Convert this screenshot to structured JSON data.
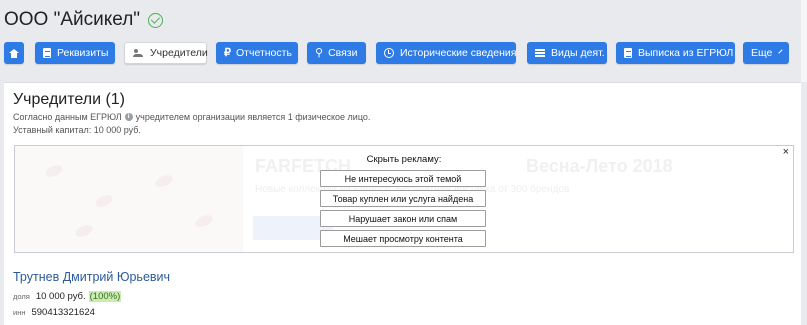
{
  "company": {
    "title": "ООО \"Айсикел\"",
    "verified_icon": "check-circle-icon"
  },
  "toolbar": {
    "home_icon": "home-icon",
    "buttons": [
      {
        "label": "Реквизиты",
        "icon": "document-icon"
      },
      {
        "label": "Учредители",
        "icon": "users-icon",
        "active": true
      },
      {
        "label": "Отчетность",
        "icon": "ruble-icon"
      },
      {
        "label": "Связи",
        "icon": "link-icon"
      },
      {
        "label": "Исторические сведения",
        "icon": "history-icon"
      },
      {
        "label": "Виды деят.",
        "icon": "list-icon"
      },
      {
        "label": "Выписка из ЕГРЮЛ",
        "icon": "document-icon"
      },
      {
        "label": "Еще",
        "icon": "chevron-down-icon"
      }
    ]
  },
  "founders": {
    "title": "Учредители (1)",
    "source_prefix": "Согласно данным ЕГРЮЛ",
    "source_suffix": "учредителем организации является 1 физическое лицо.",
    "capital": "Уставный капитал: 10 000 руб."
  },
  "ad": {
    "close_symbol": "×",
    "hide_label": "Скрыть рекламу:",
    "options": [
      "Не интересуюсь этой темой",
      "Товар куплен или услуга найдена",
      "Нарушает закон или спам",
      "Мешает просмотру контента"
    ],
    "background_title": "FARFETCH",
    "background_title_right": "Весна-Лето 2018",
    "background_text": "Новые коллекции на Farfetch. Бесплатная доставка от 300 брендов"
  },
  "person": {
    "name": "Трутнев Дмитрий Юрьевич",
    "share_label": "доля",
    "share_value": "10 000 руб.",
    "share_percent": "(100%)",
    "inn_label": "инн",
    "inn_value": "590413321624"
  }
}
